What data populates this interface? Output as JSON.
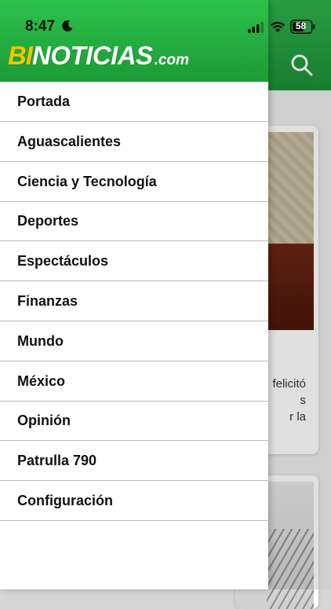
{
  "status_bar": {
    "time": "8:47",
    "battery": "58"
  },
  "logo": {
    "part_bi": "BI",
    "part_main": "NOTICIAS",
    "part_tld": ".com"
  },
  "menu": {
    "items": [
      {
        "label": "Portada"
      },
      {
        "label": "Aguascalientes"
      },
      {
        "label": "Ciencia y Tecnología"
      },
      {
        "label": "Deportes"
      },
      {
        "label": "Espectáculos"
      },
      {
        "label": "Finanzas"
      },
      {
        "label": "Mundo"
      },
      {
        "label": "México"
      },
      {
        "label": "Opinión"
      },
      {
        "label": "Patrulla 790"
      },
      {
        "label": "Configuración"
      }
    ]
  },
  "background": {
    "card1_lines": [
      "felicitó",
      "s",
      "r la"
    ]
  },
  "colors": {
    "header_green": "#1d9b37",
    "logo_yellow": "#f5c400"
  }
}
